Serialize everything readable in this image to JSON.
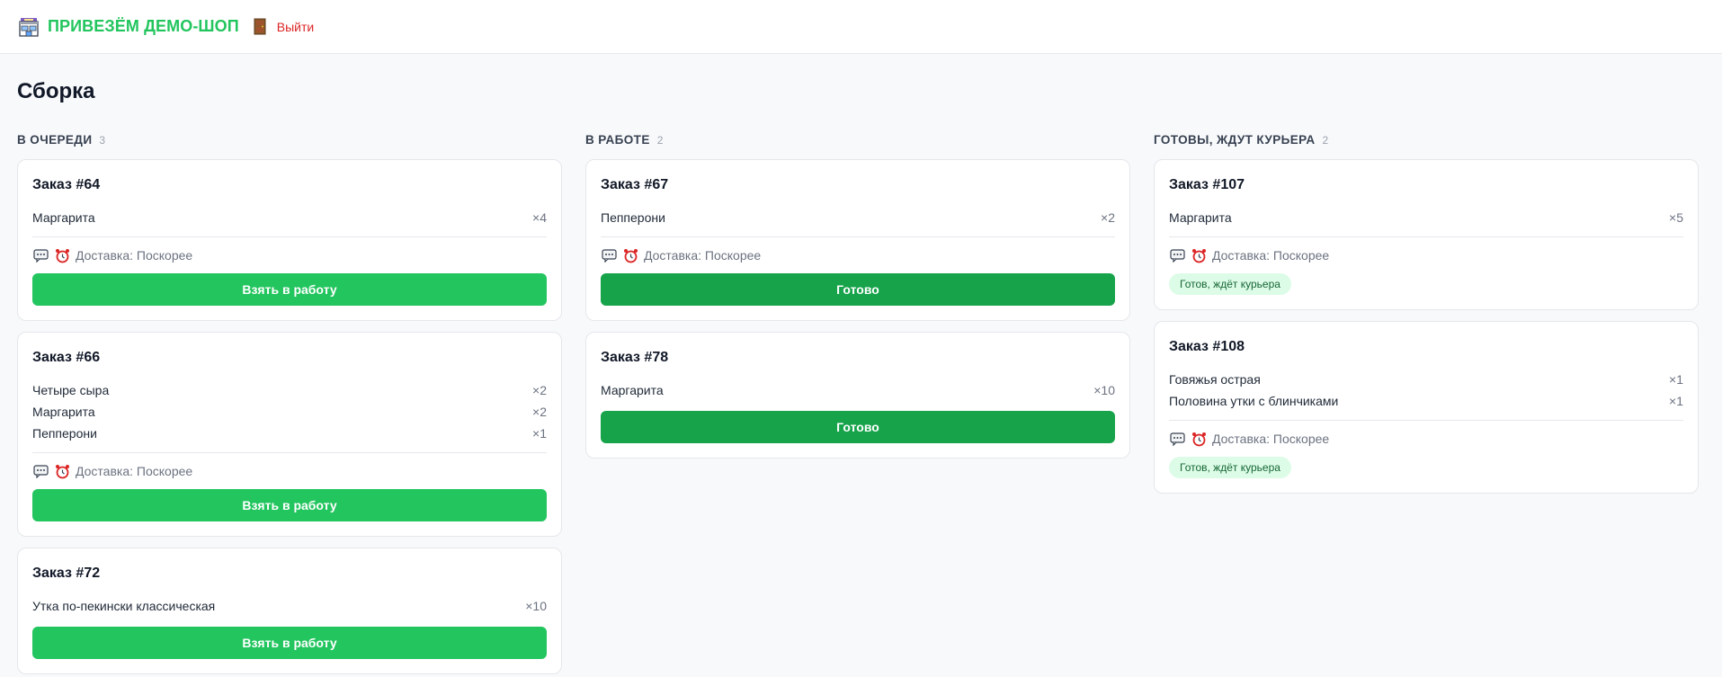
{
  "header": {
    "brand": "ПРИВЕЗЁМ ДЕМО-ШОП",
    "logout_label": "Выйти"
  },
  "page": {
    "title": "Сборка"
  },
  "columns": [
    {
      "title": "В ОЧЕРЕДИ",
      "count": "3",
      "cards": [
        {
          "title": "Заказ #64",
          "items": [
            {
              "name": "Маргарита",
              "qty": "×4"
            }
          ],
          "meta": "Доставка: Поскорее",
          "button": "Взять в работу"
        },
        {
          "title": "Заказ #66",
          "items": [
            {
              "name": "Четыре сыра",
              "qty": "×2"
            },
            {
              "name": "Маргарита",
              "qty": "×2"
            },
            {
              "name": "Пепперони",
              "qty": "×1"
            }
          ],
          "meta": "Доставка: Поскорее",
          "button": "Взять в работу"
        },
        {
          "title": "Заказ #72",
          "items": [
            {
              "name": "Утка по-пекински классическая",
              "qty": "×10"
            }
          ],
          "button": "Взять в работу"
        }
      ]
    },
    {
      "title": "В РАБОТЕ",
      "count": "2",
      "cards": [
        {
          "title": "Заказ #67",
          "items": [
            {
              "name": "Пепперони",
              "qty": "×2"
            }
          ],
          "meta": "Доставка: Поскорее",
          "button": "Готово"
        },
        {
          "title": "Заказ #78",
          "items": [
            {
              "name": "Маргарита",
              "qty": "×10"
            }
          ],
          "button": "Готово"
        }
      ]
    },
    {
      "title": "ГОТОВЫ, ЖДУТ КУРЬЕРА",
      "count": "2",
      "cards": [
        {
          "title": "Заказ #107",
          "items": [
            {
              "name": "Маргарита",
              "qty": "×5"
            }
          ],
          "meta": "Доставка: Поскорее",
          "badge": "Готов, ждёт курьера"
        },
        {
          "title": "Заказ #108",
          "items": [
            {
              "name": "Говяжья острая",
              "qty": "×1"
            },
            {
              "name": "Половина утки с блинчиками",
              "qty": "×1"
            }
          ],
          "meta": "Доставка: Поскорее",
          "badge": "Готов, ждёт курьера"
        }
      ]
    }
  ],
  "icons": {
    "shop": "shop-icon",
    "door": "door-icon",
    "comment": "speech-bubble-icon",
    "clock": "alarm-clock-icon"
  },
  "colors": {
    "brand": "#22c55e",
    "button_primary": "#22c55e",
    "button_done": "#16a34a",
    "badge_bg": "#dcfce7",
    "logout": "#dc2626"
  }
}
